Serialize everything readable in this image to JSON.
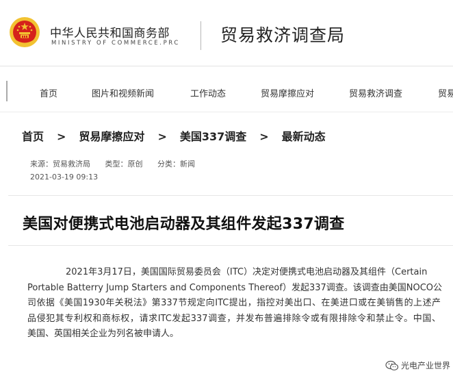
{
  "header": {
    "ministry_cn": "中华人民共和国商务部",
    "ministry_en": "MINISTRY OF COMMERCE.PRC",
    "bureau": "贸易救济调查局",
    "emblem_icon": "national-emblem-icon"
  },
  "nav": {
    "items": [
      {
        "label": "首页"
      },
      {
        "label": "图片和视频新闻"
      },
      {
        "label": "工作动态"
      },
      {
        "label": "贸易摩擦应对"
      },
      {
        "label": "贸易救济调查"
      },
      {
        "label": "贸易"
      }
    ]
  },
  "breadcrumb": {
    "items": [
      "首页",
      "贸易摩擦应对",
      "美国337调查",
      "最新动态"
    ],
    "separator": ">"
  },
  "meta": {
    "source": "来源：贸易救济局",
    "type": "类型：原创",
    "category": "分类：新闻",
    "datetime": "2021-03-19 09:13"
  },
  "article": {
    "title": "美国对便携式电池启动器及其组件发起337调查",
    "lines": [
      "2021年3月17日，美国国际贸易委员会（ITC）决定对便携式电池启动器及其组件（Certain",
      "Portable Batterry Jump Starters and Components Thereof）发起337调查。该调查由美国NOCO公",
      "司依据《美国1930年关税法》第337节规定向ITC提出，指控对美出口、在美进口或在美销售的上述产",
      "品侵犯其专利权和商标权，请求ITC发起337调查，并发布普遍排除令或有限排除令和禁止令。中国、",
      "美国、英国相关企业为列名被申请人。"
    ]
  },
  "watermark": {
    "text": "光电产业世界",
    "icon": "wechat-icon"
  },
  "colors": {
    "emblem_red": "#d5221b",
    "emblem_gold": "#f2c231",
    "text": "#333333"
  }
}
